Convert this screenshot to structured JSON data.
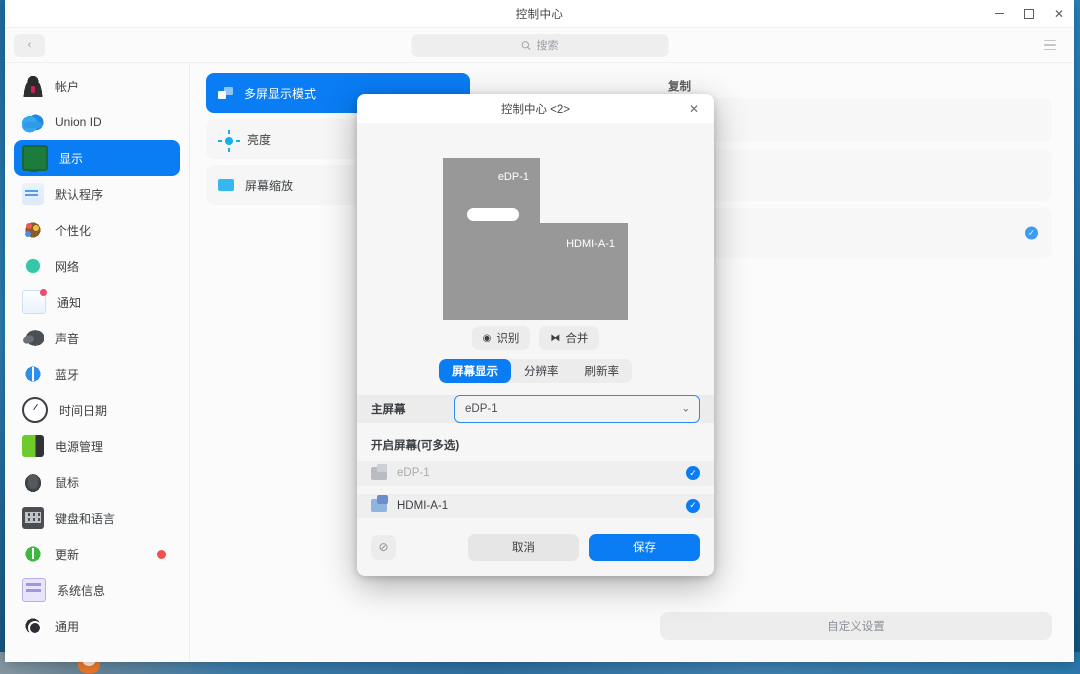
{
  "window": {
    "title": "控制中心",
    "minimize_label": "最小化",
    "maximize_label": "最大化",
    "close_label": "关闭"
  },
  "toolbar": {
    "back_label": "‹",
    "menu_label": "菜单",
    "search": {
      "placeholder": "搜索",
      "value": "",
      "icon": "search-icon"
    }
  },
  "sidebar": {
    "items": [
      {
        "label": "帐户",
        "icon": "account-icon",
        "active": false,
        "badge": false
      },
      {
        "label": "Union ID",
        "icon": "cloud-icon",
        "active": false,
        "badge": false
      },
      {
        "label": "显示",
        "icon": "display-icon",
        "active": true,
        "badge": false
      },
      {
        "label": "默认程序",
        "icon": "default-apps-icon",
        "active": false,
        "badge": false
      },
      {
        "label": "个性化",
        "icon": "palette-icon",
        "active": false,
        "badge": false
      },
      {
        "label": "网络",
        "icon": "network-icon",
        "active": false,
        "badge": false
      },
      {
        "label": "通知",
        "icon": "notification-icon",
        "active": false,
        "badge": false
      },
      {
        "label": "声音",
        "icon": "sound-icon",
        "active": false,
        "badge": false
      },
      {
        "label": "蓝牙",
        "icon": "bluetooth-icon",
        "active": false,
        "badge": false
      },
      {
        "label": "时间日期",
        "icon": "clock-icon",
        "active": false,
        "badge": false
      },
      {
        "label": "电源管理",
        "icon": "battery-icon",
        "active": false,
        "badge": false
      },
      {
        "label": "鼠标",
        "icon": "mouse-icon",
        "active": false,
        "badge": false
      },
      {
        "label": "键盘和语言",
        "icon": "keyboard-icon",
        "active": false,
        "badge": false
      },
      {
        "label": "更新",
        "icon": "update-icon",
        "active": false,
        "badge": true
      },
      {
        "label": "系统信息",
        "icon": "system-info-icon",
        "active": false,
        "badge": false
      },
      {
        "label": "通用",
        "icon": "general-icon",
        "active": false,
        "badge": false
      }
    ]
  },
  "subnav": {
    "items": [
      {
        "label": "多屏显示模式",
        "icon": "multiscreen-icon",
        "selected": true
      },
      {
        "label": "亮度",
        "icon": "brightness-icon",
        "selected": false
      },
      {
        "label": "屏幕缩放",
        "icon": "screen-scale-icon",
        "selected": false
      }
    ]
  },
  "panel": {
    "section_label": "复制",
    "rows": [
      {
        "checked": false
      },
      {
        "checked": false
      },
      {
        "checked": true
      }
    ],
    "check_glyph": "✓",
    "custom_button": "自定义设置"
  },
  "dialog": {
    "title": "控制中心 <2>",
    "close_glyph": "✕",
    "monitors": [
      {
        "name": "eDP-1"
      },
      {
        "name": "HDMI-A-1"
      }
    ],
    "monitor_buttons": [
      {
        "label": "识别",
        "icon": "target-icon",
        "glyph": "◉"
      },
      {
        "label": "合并",
        "icon": "merge-icon",
        "glyph": "⧓"
      }
    ],
    "tabs": [
      {
        "label": "屏幕显示",
        "active": true
      },
      {
        "label": "分辨率",
        "active": false
      },
      {
        "label": "刷新率",
        "active": false
      }
    ],
    "primary_screen": {
      "label": "主屏幕",
      "value": "eDP-1",
      "chevron": "⌄"
    },
    "enabled_screens": {
      "label": "开启屏幕(可多选)",
      "items": [
        {
          "name": "eDP-1",
          "icon": "laptop-screen-icon",
          "checked": true,
          "dimmed": true
        },
        {
          "name": "HDMI-A-1",
          "icon": "external-monitor-icon",
          "checked": true,
          "dimmed": false
        }
      ],
      "check_glyph": "✓"
    },
    "footer": {
      "reset_icon": "prohibited-icon",
      "reset_glyph": "⊘",
      "cancel_label": "取消",
      "save_label": "保存"
    }
  },
  "colors": {
    "accent": "#0a7cf4",
    "badge_red": "#f25050",
    "monitor_gray": "#989898",
    "desktop_blue": "#2a86bd"
  }
}
